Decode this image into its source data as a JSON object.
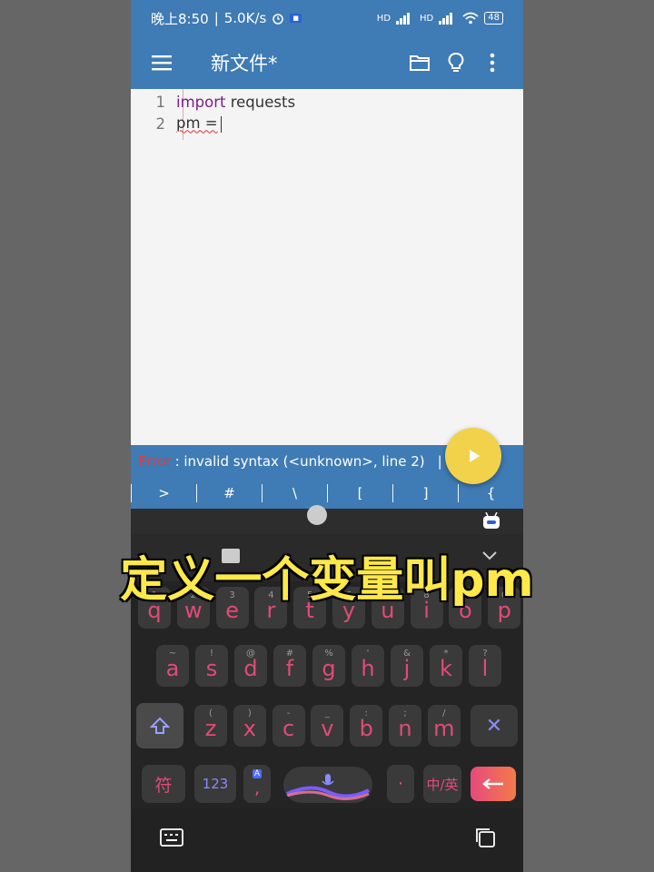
{
  "status_bar": {
    "time": "晚上8:50",
    "speed": "5.0K/s",
    "battery": "48",
    "hd1": "HD",
    "hd2": "HD"
  },
  "app_bar": {
    "title": "新文件*",
    "icons": [
      "menu-icon",
      "folder-icon",
      "lightbulb-icon",
      "more-vert-icon"
    ]
  },
  "editor": {
    "lines": [
      {
        "num": "1",
        "keyword": "import",
        "rest": " requests"
      },
      {
        "num": "2",
        "keyword": "",
        "rest": "pm ="
      }
    ]
  },
  "error_bar": {
    "label": "Error",
    "message": " : invalid syntax (<unknown>, line 2)"
  },
  "symbols": [
    ">",
    "#",
    "\\",
    "[",
    "]",
    "{"
  ],
  "keyboard": {
    "row1": [
      {
        "key": "q",
        "sub": "1"
      },
      {
        "key": "w",
        "sub": "2"
      },
      {
        "key": "e",
        "sub": "3"
      },
      {
        "key": "r",
        "sub": "4"
      },
      {
        "key": "t",
        "sub": "5"
      },
      {
        "key": "y",
        "sub": "6"
      },
      {
        "key": "u",
        "sub": "7"
      },
      {
        "key": "i",
        "sub": "8"
      },
      {
        "key": "o",
        "sub": "9"
      },
      {
        "key": "p",
        "sub": "0"
      }
    ],
    "row2": [
      {
        "key": "a",
        "sub": "~"
      },
      {
        "key": "s",
        "sub": "!"
      },
      {
        "key": "d",
        "sub": "@"
      },
      {
        "key": "f",
        "sub": "#"
      },
      {
        "key": "g",
        "sub": "%"
      },
      {
        "key": "h",
        "sub": "'"
      },
      {
        "key": "j",
        "sub": "&"
      },
      {
        "key": "k",
        "sub": "*"
      },
      {
        "key": "l",
        "sub": "?"
      }
    ],
    "row3": [
      {
        "key": "z",
        "sub": "("
      },
      {
        "key": "x",
        "sub": ")"
      },
      {
        "key": "c",
        "sub": "-"
      },
      {
        "key": "v",
        "sub": "_"
      },
      {
        "key": "b",
        "sub": ":"
      },
      {
        "key": "n",
        "sub": ";"
      },
      {
        "key": "m",
        "sub": "/"
      }
    ],
    "symbol_key": "符",
    "num_key": "123",
    "comma_key": ",",
    "comma_sub": "A",
    "period_key": "·",
    "lang_key": "中/英"
  },
  "caption": "定义一个变量叫pm",
  "colors": {
    "brand": "#3f7bb4",
    "fab": "#f2d24a",
    "key_text": "#e14b78",
    "caption": "#ffe94a",
    "error": "#e83a3a"
  }
}
